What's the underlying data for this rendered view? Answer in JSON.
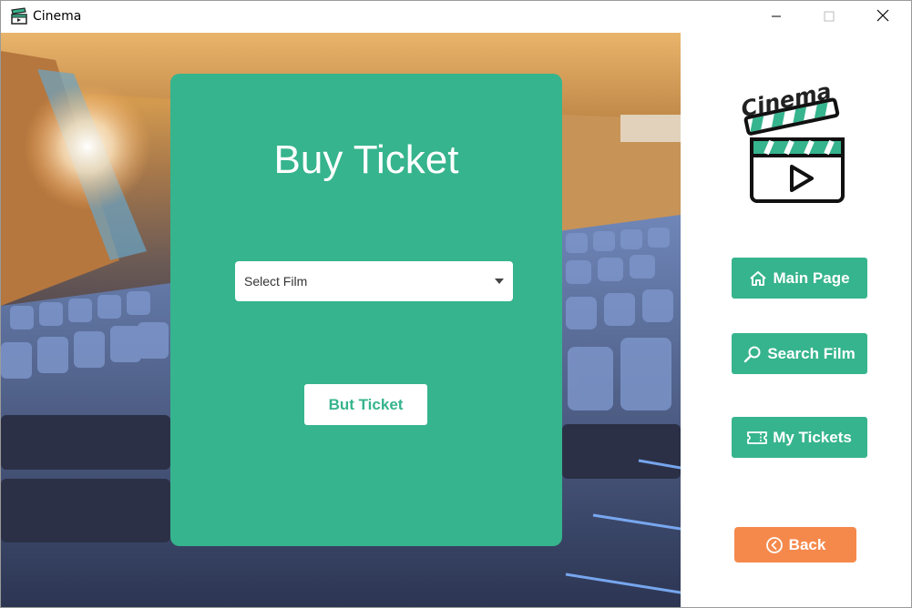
{
  "window": {
    "title": "Cinema",
    "app_icon": "clapperboard-icon",
    "controls": [
      "minimize-icon",
      "maximize-icon",
      "close-icon"
    ]
  },
  "background": {
    "image": "cinema-auditorium-seats-photo"
  },
  "card": {
    "title": "Buy Ticket",
    "select": {
      "value": "Select Film",
      "icon": "chevron-down-icon"
    },
    "button_label": "But Ticket",
    "color": "#36b48d"
  },
  "sidebar": {
    "logo_text": "Cinema",
    "logo_icon": "clapperboard-play-icon",
    "nav": [
      {
        "label": "Main Page",
        "icon": "home-icon"
      },
      {
        "label": "Search Film",
        "icon": "search-icon"
      },
      {
        "label": "My Tickets",
        "icon": "ticket-icon"
      }
    ],
    "back_label": "Back",
    "back_icon": "chevron-left-circle-icon"
  },
  "colors": {
    "accent": "#36b48d",
    "back": "#f5894c",
    "white": "#ffffff"
  }
}
